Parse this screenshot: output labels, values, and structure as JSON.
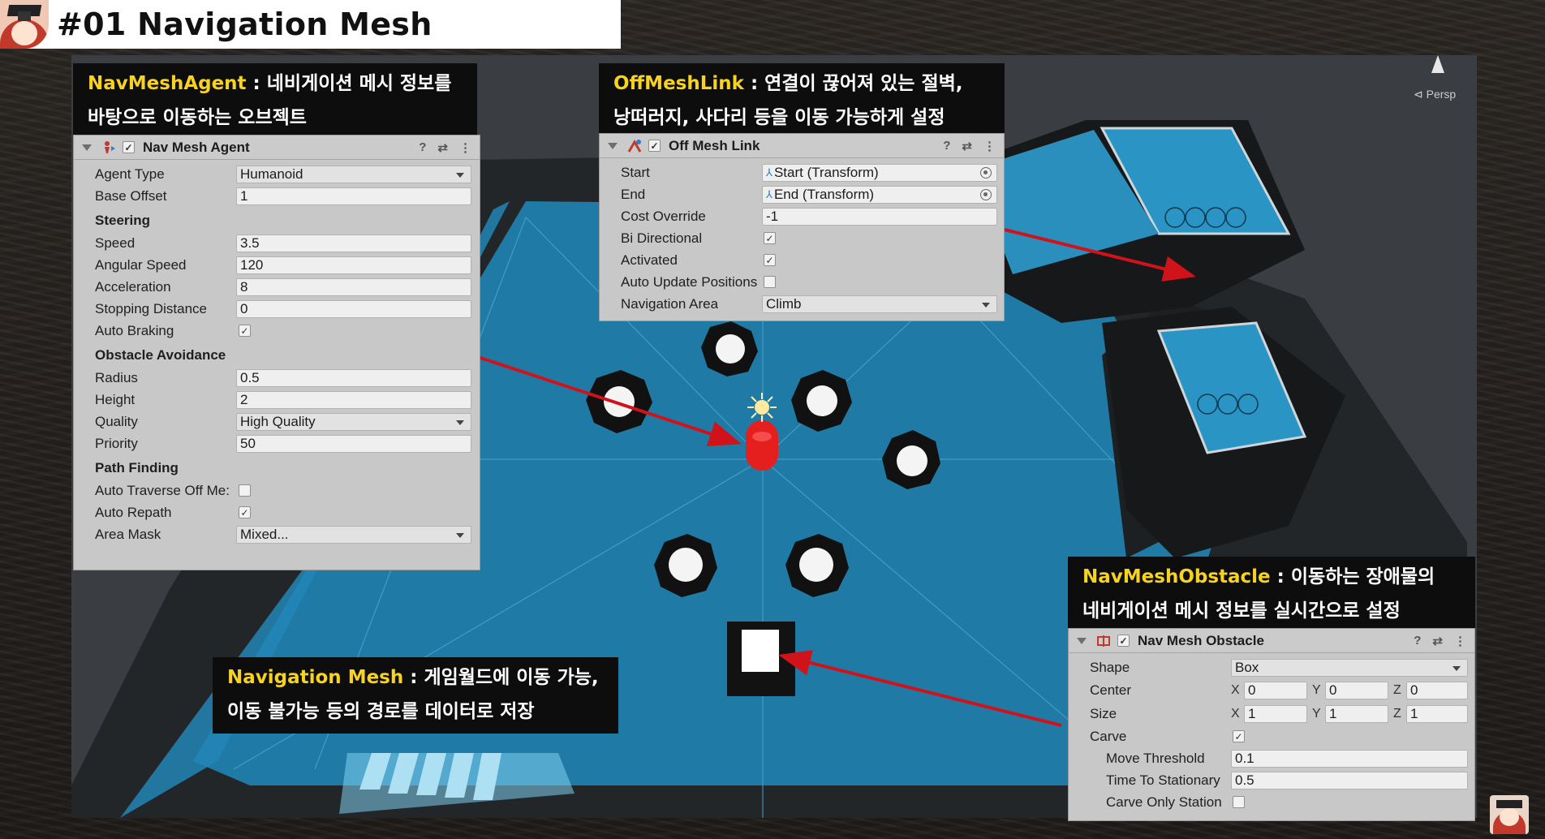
{
  "title": "#01 Navigation Mesh",
  "scene": {
    "persp_label": "⊲ Persp"
  },
  "captions": {
    "agent": {
      "highlight": "NavMeshAgent",
      "line1": " : 네비게이션 메시 정보를",
      "line2": "바탕으로 이동하는 오브젝트"
    },
    "offmesh": {
      "highlight": "OffMeshLink",
      "line1": " : 연결이 끊어져 있는 절벽,",
      "line2": "낭떠러지, 사다리 등을 이동 가능하게 설정"
    },
    "obstacle": {
      "highlight": "NavMeshObstacle",
      "line1": " : 이동하는 장애물의",
      "line2": "네비게이션 메시 정보를 실시간으로 설정"
    },
    "navmesh": {
      "highlight": "Navigation Mesh",
      "line1": " : 게임월드에 이동 가능,",
      "line2": "이동 불가능 등의 경로를 데이터로 저장"
    }
  },
  "nav_mesh_agent": {
    "header": "Nav Mesh Agent",
    "agent_type_label": "Agent Type",
    "agent_type": "Humanoid",
    "base_offset_label": "Base Offset",
    "base_offset": "1",
    "steering_label": "Steering",
    "speed_label": "Speed",
    "speed": "3.5",
    "angular_speed_label": "Angular Speed",
    "angular_speed": "120",
    "acceleration_label": "Acceleration",
    "acceleration": "8",
    "stopping_distance_label": "Stopping Distance",
    "stopping_distance": "0",
    "auto_braking_label": "Auto Braking",
    "auto_braking": true,
    "obstacle_avoidance_label": "Obstacle Avoidance",
    "radius_label": "Radius",
    "radius": "0.5",
    "height_label": "Height",
    "height": "2",
    "quality_label": "Quality",
    "quality": "High Quality",
    "priority_label": "Priority",
    "priority": "50",
    "path_finding_label": "Path Finding",
    "auto_traverse_label": "Auto Traverse Off Me:",
    "auto_traverse": false,
    "auto_repath_label": "Auto Repath",
    "auto_repath": true,
    "area_mask_label": "Area Mask",
    "area_mask": "Mixed..."
  },
  "off_mesh_link": {
    "header": "Off Mesh Link",
    "start_label": "Start",
    "start": "Start (Transform)",
    "end_label": "End",
    "end": "End (Transform)",
    "cost_override_label": "Cost Override",
    "cost_override": "-1",
    "bi_directional_label": "Bi Directional",
    "bi_directional": true,
    "activated_label": "Activated",
    "activated": true,
    "auto_update_label": "Auto Update Positions",
    "auto_update": false,
    "navigation_area_label": "Navigation Area",
    "navigation_area": "Climb"
  },
  "nav_mesh_obstacle": {
    "header": "Nav Mesh Obstacle",
    "shape_label": "Shape",
    "shape": "Box",
    "center_label": "Center",
    "center": {
      "x": "0",
      "y": "0",
      "z": "0"
    },
    "size_label": "Size",
    "size": {
      "x": "1",
      "y": "1",
      "z": "1"
    },
    "axis": {
      "x": "X",
      "y": "Y",
      "z": "Z"
    },
    "carve_label": "Carve",
    "carve": true,
    "move_threshold_label": "Move Threshold",
    "move_threshold": "0.1",
    "time_to_stationary_label": "Time To Stationary",
    "time_to_stationary": "0.5",
    "carve_only_stationary_label": "Carve Only Station",
    "carve_only_stationary": false
  },
  "icons": {
    "help": "?",
    "preset": "⇄",
    "menu": "⋮",
    "check": "✓"
  },
  "colors": {
    "navmesh": "#1f7aa6",
    "highlight": "#f7d21e",
    "arrow": "#d0121b",
    "agent": "#e51e1e"
  }
}
